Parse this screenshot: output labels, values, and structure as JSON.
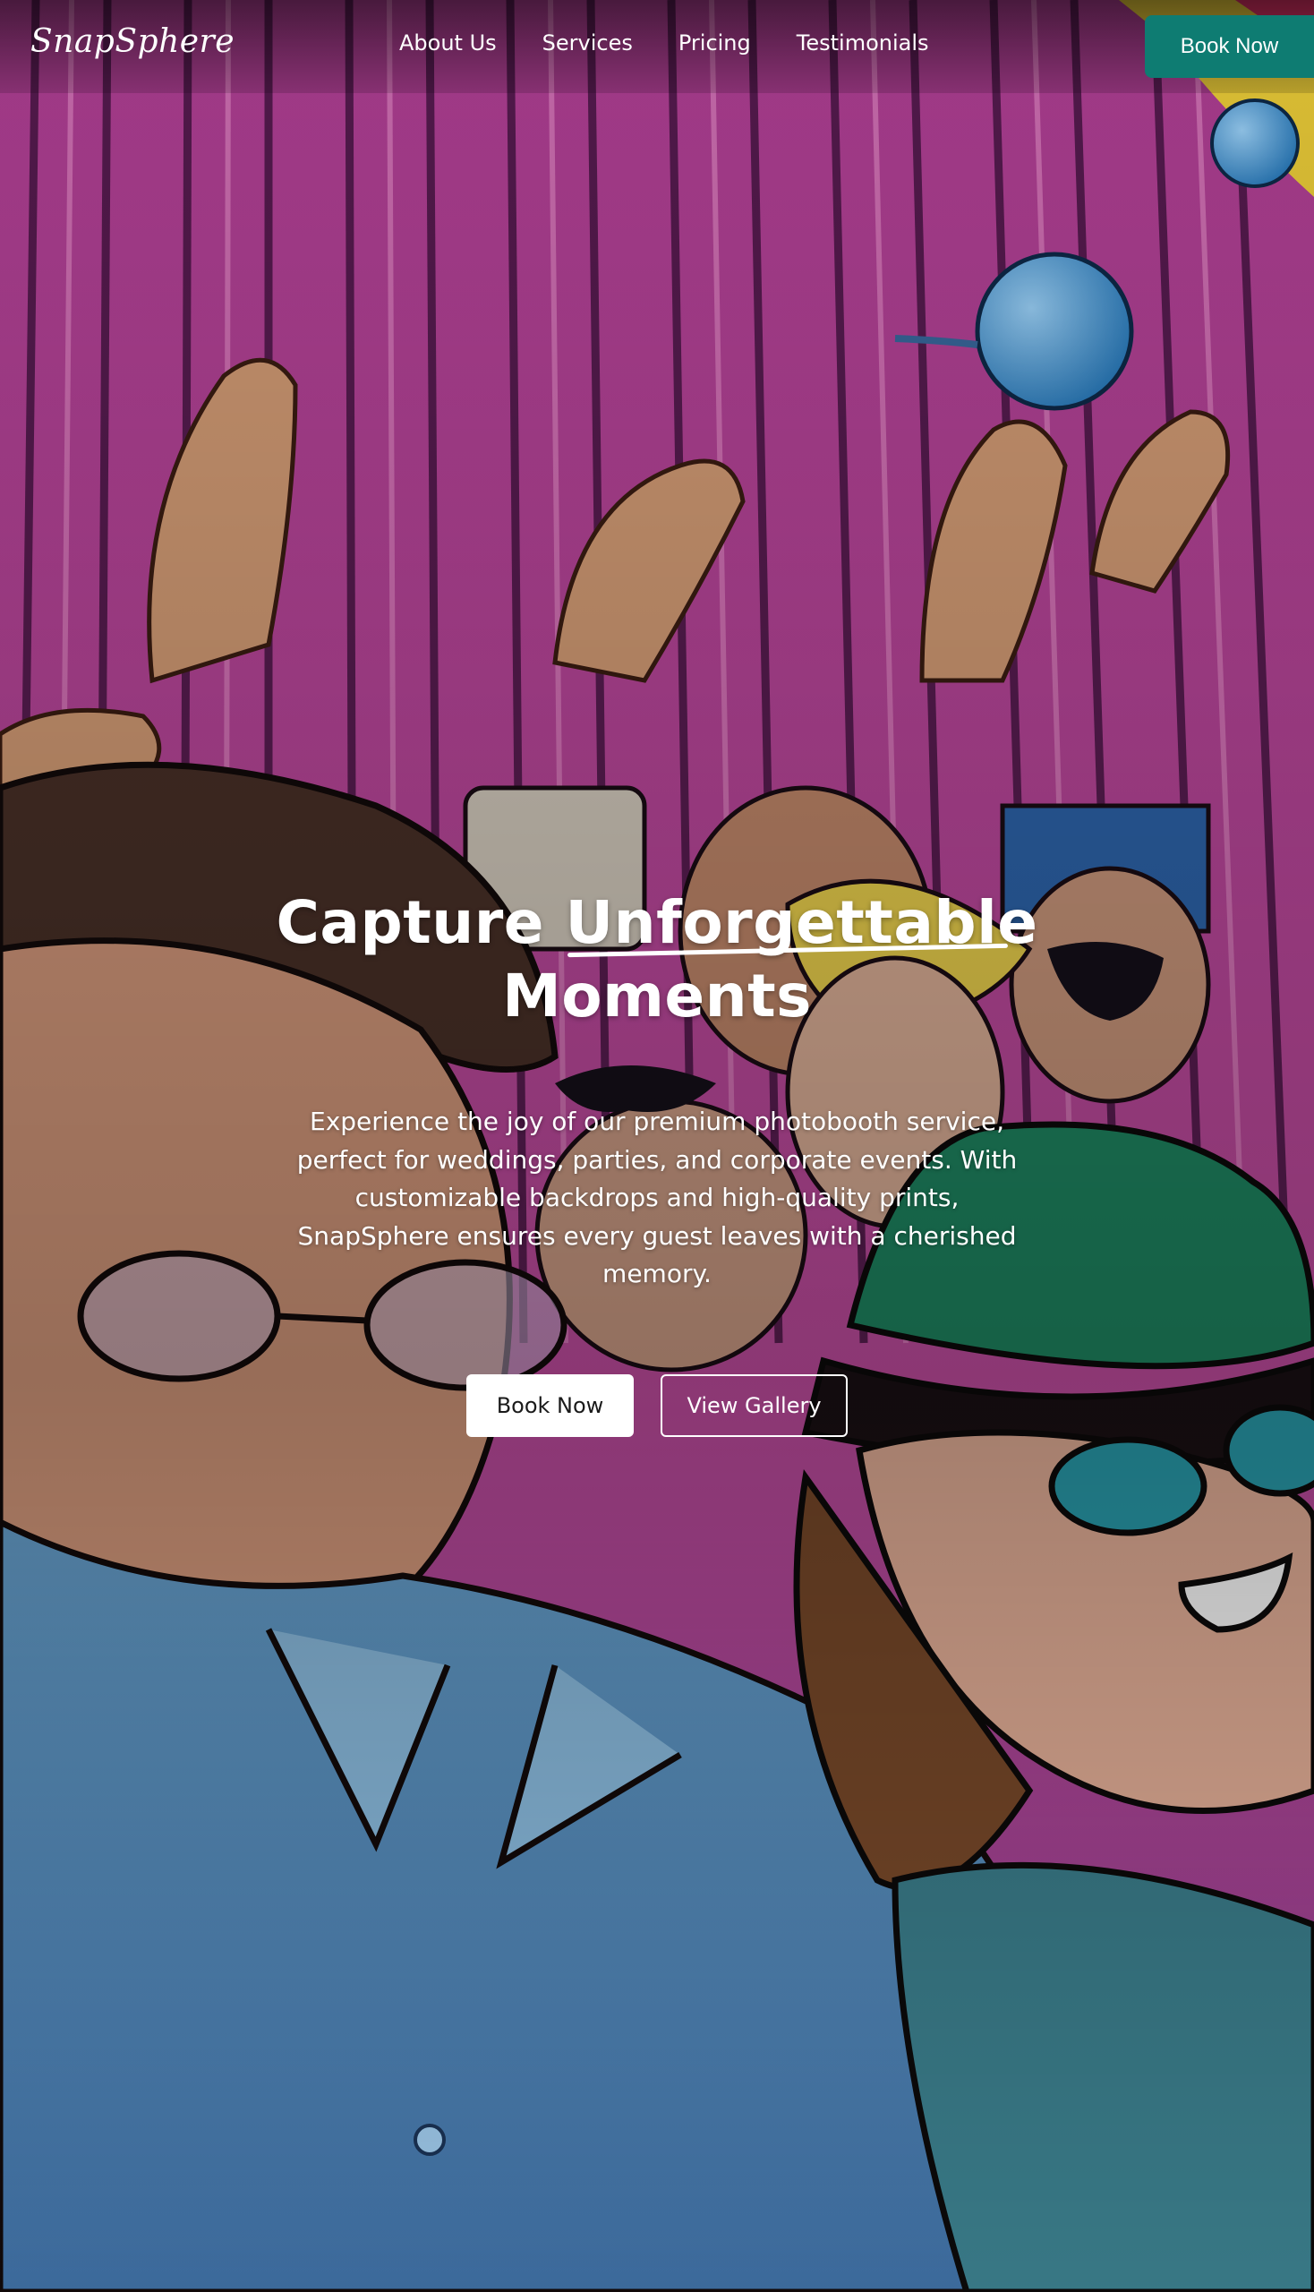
{
  "brand": {
    "logo_text": "SnapSphere"
  },
  "nav": {
    "links": [
      {
        "label": "About Us"
      },
      {
        "label": "Services"
      },
      {
        "label": "Pricing"
      },
      {
        "label": "Testimonials"
      }
    ],
    "cta_label": "Book Now"
  },
  "hero": {
    "title_part1": "Capture ",
    "title_highlight": "Unforgettable",
    "title_part2": "Moments",
    "subtitle": "Experience the joy of our premium photobooth service, perfect for weddings, parties, and corporate events. With customizable backdrops and high-quality prints, SnapSphere ensures every guest leaves with a cherished memory.",
    "primary_button": "Book Now",
    "secondary_button": "View Gallery",
    "background_image": "party-illustration"
  },
  "colors": {
    "accent_teal": "#0e7c72",
    "curtain_pink": "#c0499f",
    "balloon_blue": "#49a4e0"
  }
}
